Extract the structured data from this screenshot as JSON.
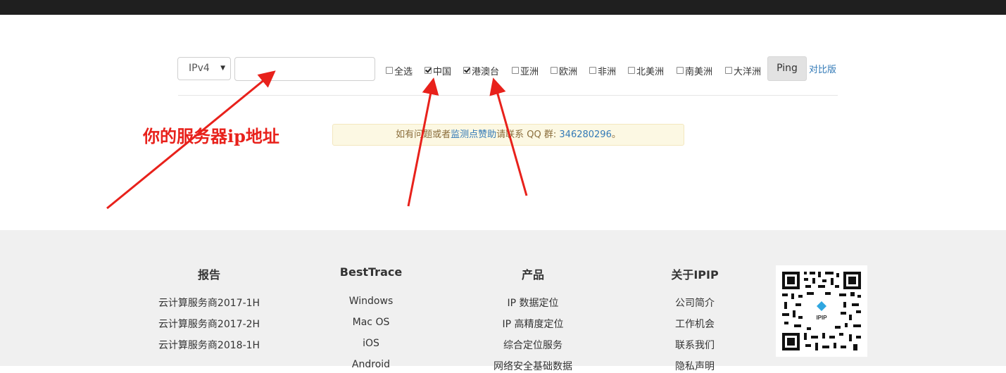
{
  "controls": {
    "ip_version": "IPv4",
    "ip_input_value": "",
    "checkboxes": [
      {
        "label": "全选",
        "checked": false
      },
      {
        "label": "中国",
        "checked": true
      },
      {
        "label": "港澳台",
        "checked": true
      },
      {
        "label": "亚洲",
        "checked": false
      },
      {
        "label": "欧洲",
        "checked": false
      },
      {
        "label": "非洲",
        "checked": false
      },
      {
        "label": "北美洲",
        "checked": false
      },
      {
        "label": "南美洲",
        "checked": false
      },
      {
        "label": "大洋洲",
        "checked": false
      }
    ],
    "ping_label": "Ping",
    "compare_label": "对比版"
  },
  "notice": {
    "prefix": "如有问题或者",
    "link_text": "监测点赞助",
    "middle": "请联系 QQ 群: ",
    "qq": "346280296",
    "suffix": "。"
  },
  "annotation": {
    "text": "你的服务器ip地址",
    "color": "#e8211b"
  },
  "footer": {
    "columns": [
      {
        "title": "报告",
        "items": [
          "云计算服务商2017-1H",
          "云计算服务商2017-2H",
          "云计算服务商2018-1H"
        ]
      },
      {
        "title": "BestTrace",
        "items": [
          "Windows",
          "Mac OS",
          "iOS",
          "Android"
        ]
      },
      {
        "title": "产品",
        "items": [
          "IP 数据定位",
          "IP 高精度定位",
          "综合定位服务",
          "网络安全基础数据"
        ]
      },
      {
        "title": "关于IPIP",
        "items": [
          "公司简介",
          "工作机会",
          "联系我们",
          "隐私声明"
        ]
      }
    ],
    "qr_logo_text": "IPIP"
  },
  "colors": {
    "topbar": "#1f1f1f",
    "link": "#337ab7",
    "notice_bg": "#fcf8e3",
    "footer_bg": "#f0f0f0",
    "annotation": "#e8211b"
  }
}
